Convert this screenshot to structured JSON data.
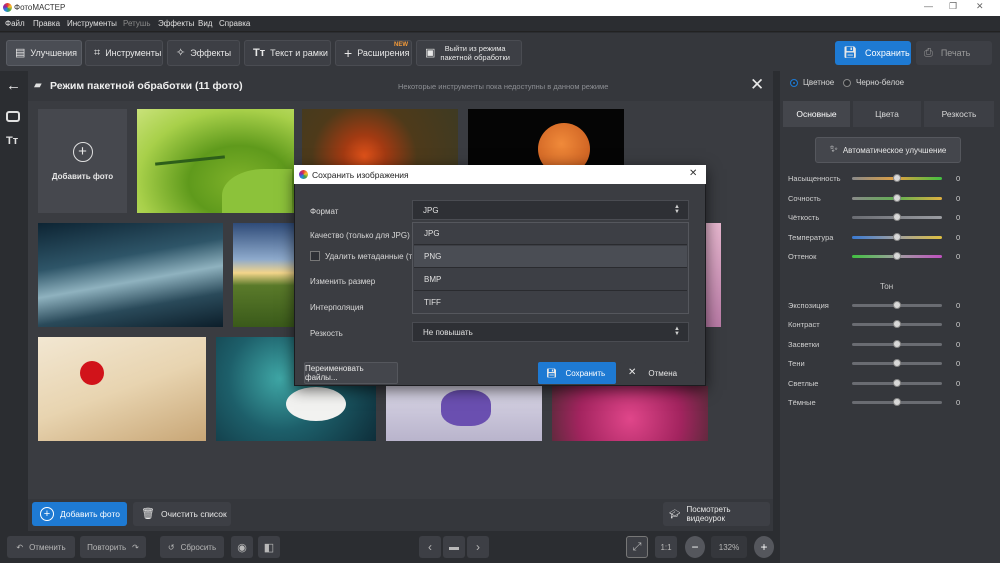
{
  "window": {
    "title": "ФотоМАСТЕР",
    "minimize_icon": "minimize-icon",
    "maximize_icon": "maximize-icon",
    "close_icon": "close-icon"
  },
  "menu": [
    "Файл",
    "Правка",
    "Инструменты",
    "Ретушь",
    "Эффекты",
    "Вид",
    "Справка"
  ],
  "toolbar": {
    "tabs": [
      {
        "label": "Улучшения",
        "icon": "enhance-icon",
        "active": true
      },
      {
        "label": "Инструменты",
        "icon": "crop-icon"
      },
      {
        "label": "Эффекты",
        "icon": "magic-wand-icon"
      },
      {
        "label": "Текст и рамки",
        "icon": "text-icon"
      },
      {
        "label": "Расширения",
        "icon": "plus-icon",
        "badge": "NEW"
      }
    ],
    "exit_batch_line1": "Выйти из режима",
    "exit_batch_line2": "пакетной обработки",
    "save_label": "Сохранить",
    "print_label": "Печать"
  },
  "main": {
    "title": "Режим пакетной обработки (11 фото)",
    "note": "Некоторые инструменты пока недоступны в данном режиме",
    "add_tile_label": "Добавить фото",
    "add_photo_button": "Добавить фото",
    "clear_list_button": "Очистить список",
    "watch_video_button": "Посмотреть видеоурок"
  },
  "statusbar": {
    "undo": "Отменить",
    "redo": "Повторить",
    "reset": "Сбросить",
    "ratio": "1:1",
    "zoom": "132%"
  },
  "dialog": {
    "title": "Сохранить изображения",
    "format_label": "Формат",
    "format_value": "JPG",
    "quality_label": "Качество (только для JPG)",
    "remove_metadata_label": "Удалить метаданные (т",
    "resize_label": "Изменить размер",
    "interpolation_label": "Интерполяция",
    "sharpness_label": "Резкость",
    "sharpness_value": "Не повышать",
    "format_options": [
      "JPG",
      "PNG",
      "BMP",
      "TIFF"
    ],
    "rename_button": "Переименовать файлы...",
    "save_button": "Сохранить",
    "cancel_button": "Отмена"
  },
  "right_panel": {
    "color_mode": "Цветное",
    "bw_mode": "Черно-белое",
    "tabs": [
      "Основные",
      "Цвета",
      "Резкость"
    ],
    "auto_button": "Автоматическое улучшение",
    "tone_header": "Тон",
    "sliders": [
      {
        "label": "Насыщенность",
        "value": "0"
      },
      {
        "label": "Сочность",
        "value": "0"
      },
      {
        "label": "Чёткость",
        "value": "0"
      },
      {
        "label": "Температура",
        "value": "0"
      },
      {
        "label": "Оттенок",
        "value": "0"
      },
      {
        "label": "Экспозиция",
        "value": "0"
      },
      {
        "label": "Контраст",
        "value": "0"
      },
      {
        "label": "Засветки",
        "value": "0"
      },
      {
        "label": "Тени",
        "value": "0"
      },
      {
        "label": "Светлые",
        "value": "0"
      },
      {
        "label": "Тёмные",
        "value": "0"
      }
    ]
  },
  "colors": {
    "accent": "#1e7ad3",
    "badge": "#f29a3a",
    "panel": "#35373c",
    "workspace": "#3a3c41"
  }
}
